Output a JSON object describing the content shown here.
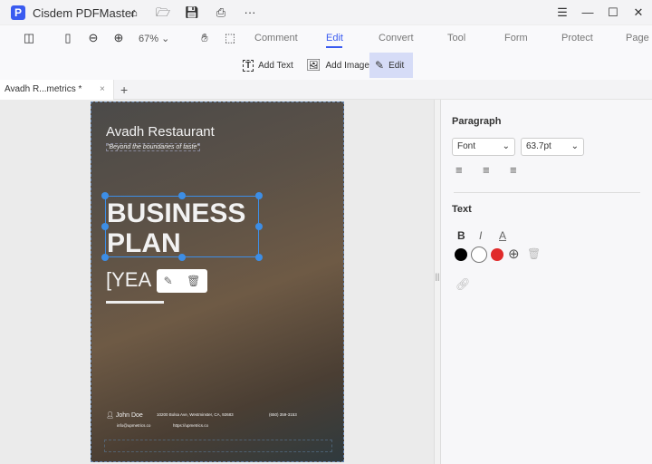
{
  "app": {
    "title": "Cisdem PDFMaster",
    "logo_letter": "P"
  },
  "toolbar": {
    "zoom": "67%",
    "menus": [
      "Comment",
      "Edit",
      "Convert",
      "Tool",
      "Form",
      "Protect",
      "Page"
    ],
    "active_menu": "Edit"
  },
  "subtoolbar": {
    "add_text": "Add Text",
    "add_image": "Add Image",
    "edit": "Edit"
  },
  "tabs": [
    {
      "label": "Avadh R...metrics *"
    }
  ],
  "page": {
    "restaurant": "Avadh Restaurant",
    "tagline": "\"Beyond the boundaries of taste\"",
    "heading_line1": "BUSINESS",
    "heading_line2": "PLAN",
    "year": "[YEA",
    "name": "John Doe",
    "address": "10200 Bolsa Ave, Westminster, CA, 92683",
    "phone": "(650) 359-3153",
    "email": "info@upmetrics.co",
    "website": "https://upmetrics.co"
  },
  "panel": {
    "paragraph_title": "Paragraph",
    "font": "Font",
    "size": "63.7pt",
    "text_title": "Text",
    "bold": "B",
    "italic": "I",
    "color_letter": "A",
    "colors": [
      "#000000",
      "#ffffff",
      "#e02a2a"
    ]
  }
}
